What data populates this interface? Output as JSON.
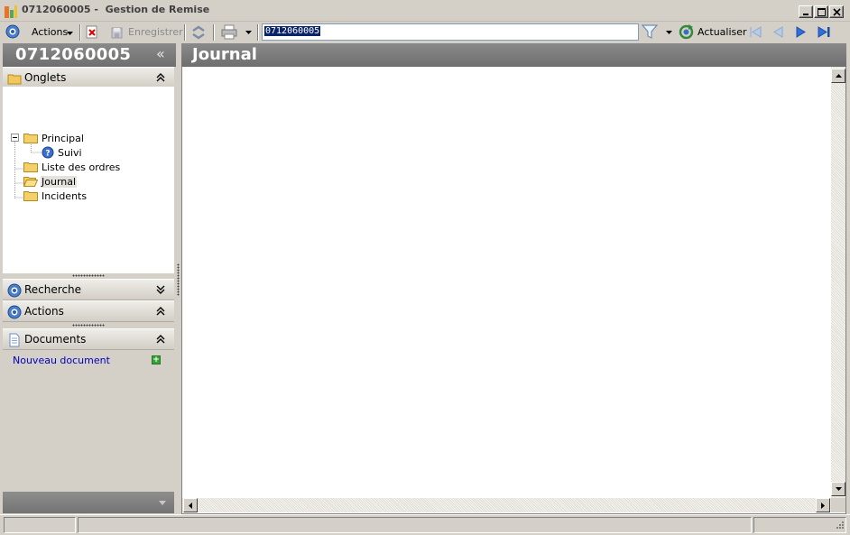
{
  "window": {
    "title": "0712060005 -  Gestion de Remise"
  },
  "toolbar": {
    "actions_label": "Actions",
    "save_label": "Enregistrer",
    "search_value": "0712060005",
    "refresh_label": "Actualiser"
  },
  "left_panel": {
    "title": "0712060005",
    "collapse_glyph": "«",
    "sections": {
      "tabs": "Onglets",
      "search": "Recherche",
      "actions": "Actions",
      "documents": "Documents"
    },
    "tree": [
      {
        "label": "Principal",
        "icon": "folder-icon",
        "expanded": true
      },
      {
        "label": "Suivi",
        "icon": "help-icon"
      },
      {
        "label": "Liste des ordres",
        "icon": "folder-icon"
      },
      {
        "label": "Journal",
        "icon": "folder-open-icon",
        "selected": true
      },
      {
        "label": "Incidents",
        "icon": "folder-icon"
      }
    ],
    "new_document": "Nouveau document"
  },
  "main": {
    "title": "Journal"
  },
  "colors": {
    "header_bg": "#7c7c7c",
    "link": "#0000c0",
    "selection": "#0a246a"
  }
}
